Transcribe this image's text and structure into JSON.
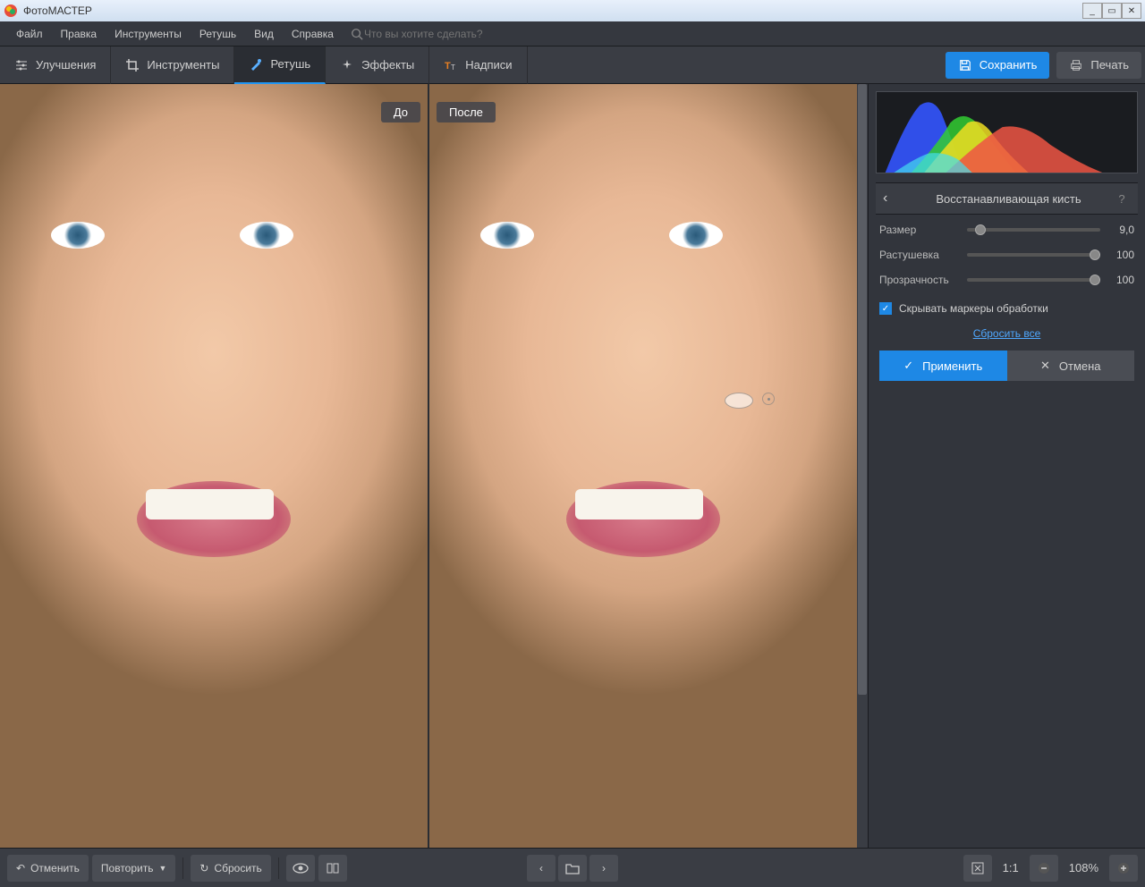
{
  "titlebar": {
    "app_name": "ФотоМАСТЕР"
  },
  "menu": {
    "items": [
      "Файл",
      "Правка",
      "Инструменты",
      "Ретушь",
      "Вид",
      "Справка"
    ],
    "search_placeholder": "Что вы хотите сделать?"
  },
  "toolbar": {
    "tabs": [
      {
        "label": "Улучшения",
        "icon": "sliders"
      },
      {
        "label": "Инструменты",
        "icon": "crop"
      },
      {
        "label": "Ретушь",
        "icon": "brush",
        "active": true
      },
      {
        "label": "Эффекты",
        "icon": "sparkle"
      },
      {
        "label": "Надписи",
        "icon": "text"
      }
    ],
    "save_label": "Сохранить",
    "print_label": "Печать"
  },
  "canvas": {
    "before_label": "До",
    "after_label": "После"
  },
  "panel": {
    "title": "Восстанавливающая кисть",
    "sliders": [
      {
        "label": "Размер",
        "value": "9,0",
        "pos": 6
      },
      {
        "label": "Растушевка",
        "value": "100",
        "pos": 100
      },
      {
        "label": "Прозрачность",
        "value": "100",
        "pos": 100
      }
    ],
    "hide_markers_label": "Скрывать маркеры обработки",
    "hide_markers_checked": true,
    "reset_all": "Сбросить все",
    "apply_label": "Применить",
    "cancel_label": "Отмена"
  },
  "bottom": {
    "undo_label": "Отменить",
    "redo_label": "Повторить",
    "reset_label": "Сбросить",
    "zoom_ratio": "1:1",
    "zoom_percent": "108%"
  }
}
